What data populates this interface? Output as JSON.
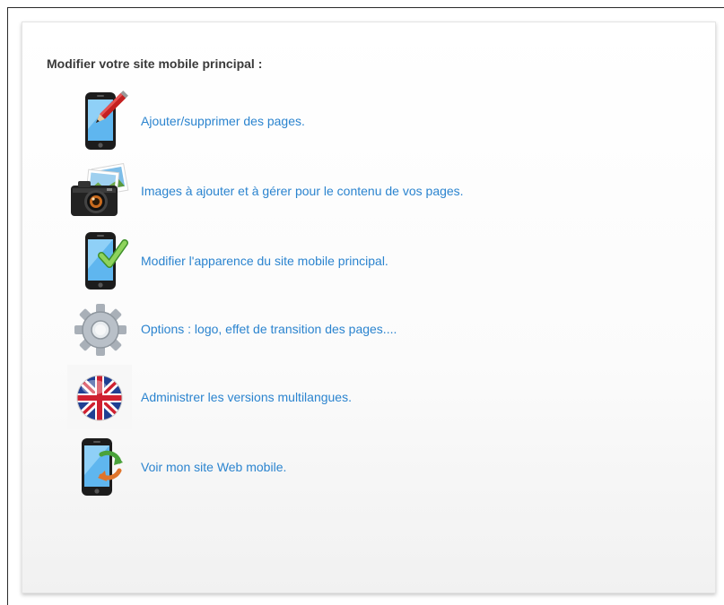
{
  "panel": {
    "title": "Modifier votre site mobile principal :"
  },
  "menu": {
    "items": [
      {
        "label": "Ajouter/supprimer des pages.",
        "icon": "phone-pen-icon"
      },
      {
        "label": "Images à ajouter et à gérer pour le contenu de vos pages.",
        "icon": "camera-photos-icon"
      },
      {
        "label": "Modifier l'apparence du site mobile principal.",
        "icon": "phone-check-icon"
      },
      {
        "label": "Options : logo, effet de transition des pages....",
        "icon": "gear-icon"
      },
      {
        "label": "Administrer les versions multilangues.",
        "icon": "uk-flag-globe-icon"
      },
      {
        "label": "Voir mon site Web mobile.",
        "icon": "phone-refresh-icon"
      }
    ]
  },
  "colors": {
    "link": "#2b84cf",
    "title": "#3a3a3a"
  }
}
